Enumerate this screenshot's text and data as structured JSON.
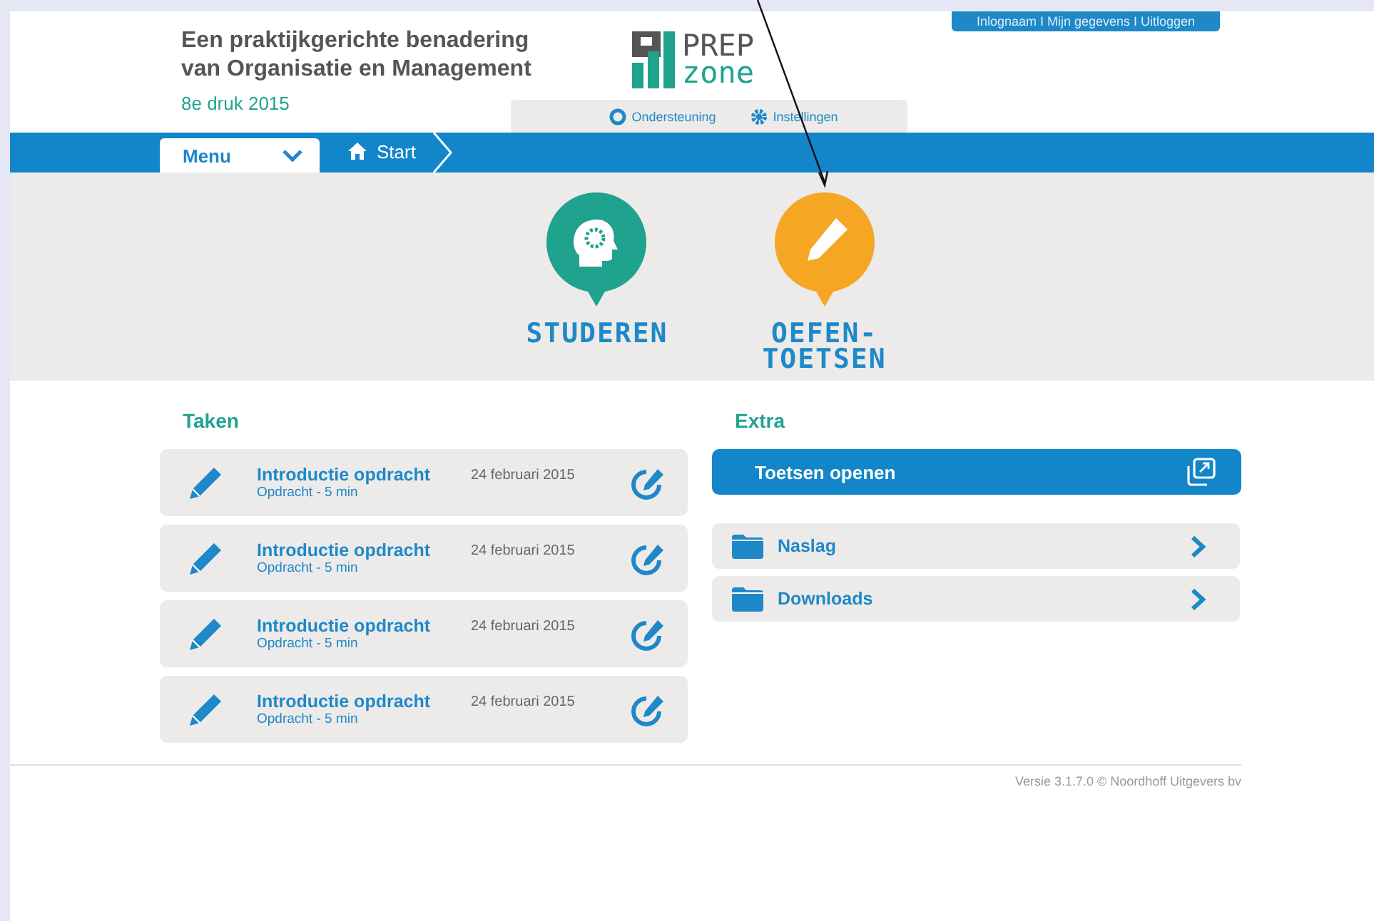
{
  "header": {
    "title_line1": "Een praktijkgerichte benadering",
    "title_line2": "van  Organisatie en Management",
    "edition": "8e druk 2015",
    "logo_top": "PREP",
    "logo_bottom": "zone",
    "account_links": "Inlognaam I Mijn gegevens I Uitloggen",
    "support_links": [
      {
        "kind": "support",
        "label": "Ondersteuning"
      },
      {
        "kind": "settings",
        "label": "Instellingen"
      }
    ]
  },
  "navbar": {
    "menu_label": "Menu",
    "breadcrumb": "Start"
  },
  "tiles": [
    {
      "kind": "study",
      "color": "#1fa38f",
      "lines": [
        "STUDEREN"
      ]
    },
    {
      "kind": "practice",
      "color": "#f5a623",
      "lines": [
        "OEFEN-",
        "TOETSEN"
      ]
    }
  ],
  "tasks": {
    "heading": "Taken",
    "items": [
      {
        "title": "Introductie opdracht",
        "subtitle": "Opdracht - 5 min",
        "date": "24 februari 2015"
      },
      {
        "title": "Introductie opdracht",
        "subtitle": "Opdracht - 5 min",
        "date": "24 februari 2015"
      },
      {
        "title": "Introductie opdracht",
        "subtitle": "Opdracht - 5 min",
        "date": "24 februari 2015"
      },
      {
        "title": "Introductie opdracht",
        "subtitle": "Opdracht - 5 min",
        "date": "24 februari 2015"
      }
    ]
  },
  "extra": {
    "heading": "Extra",
    "primary_button": "Toetsen openen",
    "folders": [
      {
        "label": "Naslag"
      },
      {
        "label": "Downloads"
      }
    ]
  },
  "footer": {
    "version": "Versie 3.1.7.0 © Noordhoff Uitgevers bv"
  }
}
